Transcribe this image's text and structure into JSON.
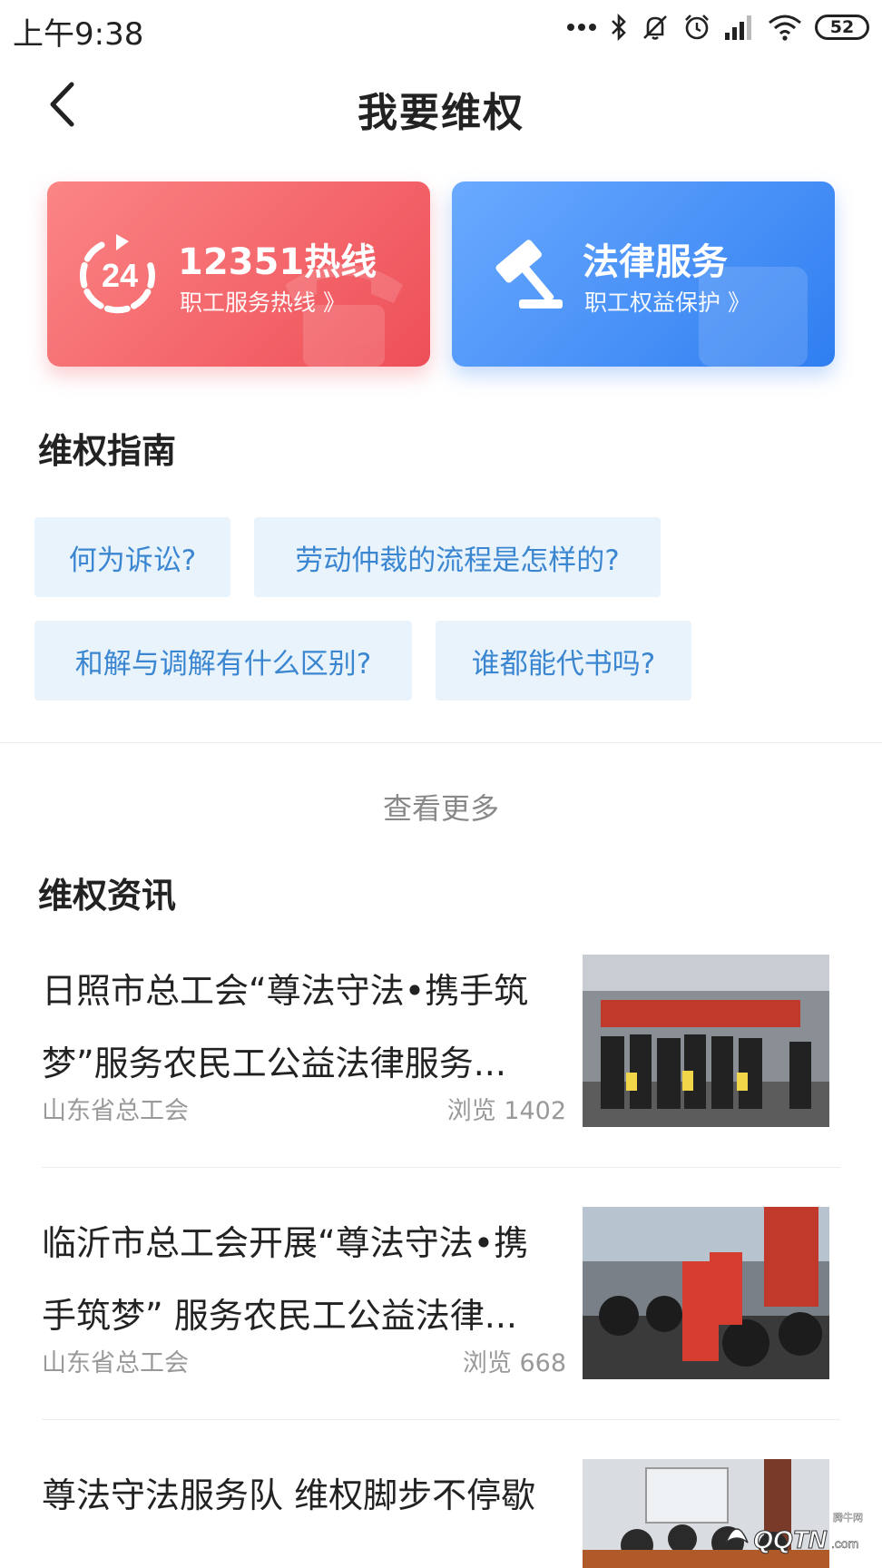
{
  "status_bar": {
    "time": "上午9:38",
    "battery": "52",
    "icons": [
      "more-dots-icon",
      "bluetooth-icon",
      "mute-icon",
      "alarm-icon",
      "signal-icon",
      "wifi-icon",
      "battery-icon"
    ]
  },
  "header": {
    "title": "我要维权",
    "back_icon": "back-arrow-icon"
  },
  "cards": [
    {
      "title": "12351热线",
      "subtitle": "职工服务热线 》",
      "icon": "hotline-24-icon",
      "color": "#ee4f58"
    },
    {
      "title": "法律服务",
      "subtitle": "职工权益保护 》",
      "icon": "gavel-icon",
      "color": "#2f7ef1"
    }
  ],
  "guide": {
    "title": "维权指南",
    "chips": [
      "何为诉讼?",
      "劳动仲裁的流程是怎样的?",
      "和解与调解有什么区别?",
      "谁都能代书吗?"
    ],
    "more": "查看更多"
  },
  "news": {
    "title": "维权资讯",
    "items": [
      {
        "title": "日照市总工会“尊法守法•携手筑梦”服务农民工公益法律服务...",
        "source": "山东省总工会",
        "views": "浏览 1402"
      },
      {
        "title": "临沂市总工会开展“尊法守法•携手筑梦” 服务农民工公益法律...",
        "source": "山东省总工会",
        "views": "浏览 668"
      },
      {
        "title": "尊法守法服务队 维权脚步不停歇",
        "source": "",
        "views": ""
      }
    ]
  },
  "watermark": {
    "text": "QQTN",
    "suffix": ".com",
    "top_text": "腾牛网"
  },
  "colors": {
    "accent_blue": "#3b86d1",
    "chip_bg": "#e9f3fc",
    "hotline_red": "#ee4f58",
    "legal_blue": "#2f7ef1"
  }
}
